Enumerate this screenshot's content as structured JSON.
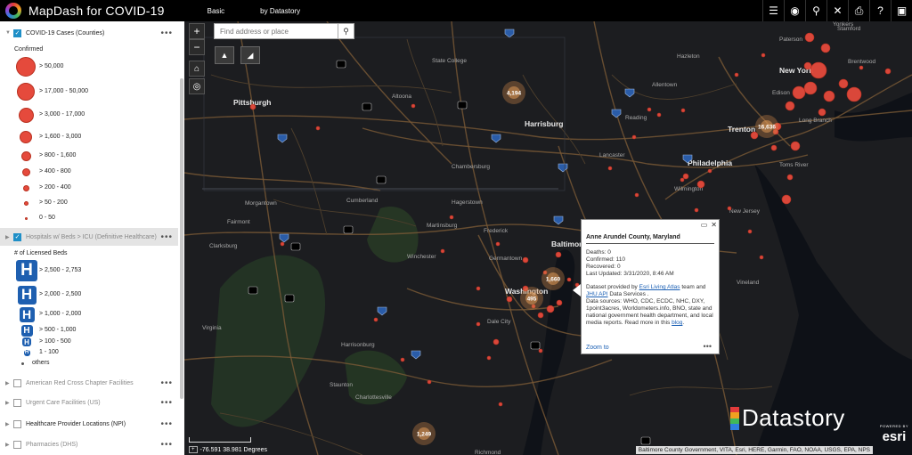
{
  "header": {
    "title": "MapDash for COVID-19",
    "tab": "Basic",
    "by": "by Datastory",
    "tools": [
      {
        "name": "list-icon",
        "glyph": "☰"
      },
      {
        "name": "basemap-icon",
        "glyph": "◉"
      },
      {
        "name": "location-icon",
        "glyph": "⚲"
      },
      {
        "name": "tools-icon",
        "glyph": "✕"
      },
      {
        "name": "print-icon",
        "glyph": "⎙"
      },
      {
        "name": "help-icon",
        "glyph": "?"
      },
      {
        "name": "share-icon",
        "glyph": "▣"
      }
    ]
  },
  "sidebar": {
    "layer1": {
      "name": "COVID-19 Cases (Counties)",
      "legend_title": "Confirmed",
      "classes": [
        "> 50,000",
        "> 17,000 - 50,000",
        "> 3,000 - 17,000",
        "> 1,600 - 3,000",
        "> 800 - 1,600",
        "> 400 - 800",
        "> 200 - 400",
        "> 50 - 200",
        "0 - 50"
      ]
    },
    "layer2": {
      "name": "Hospitals w/ Beds > ICU (Definitive Healthcare)",
      "legend_title": "# of Licensed Beds",
      "classes": [
        "> 2,500 - 2,753",
        "> 2,000 - 2,500",
        "> 1,000 - 2,000",
        "> 500 - 1,000",
        "> 100 - 500",
        "1 - 100",
        "others"
      ]
    },
    "other_layers": [
      "American Red Cross Chapter Facilities",
      "Urgent Care Facilities (US)",
      "Healthcare Provider Locations (NPI)",
      "Pharmacies (DHS)"
    ],
    "menu_glyph": "•••",
    "hospital_glyph": "H"
  },
  "map": {
    "search_placeholder": "Find address or place",
    "zoom_in": "+",
    "zoom_out": "−",
    "cities": [
      {
        "name": "Pittsburgh",
        "big": true
      },
      {
        "name": "Harrisburg",
        "big": true
      },
      {
        "name": "Philadelphia",
        "big": true
      },
      {
        "name": "Washington",
        "big": true
      },
      {
        "name": "Baltimore",
        "big": true
      },
      {
        "name": "Trenton",
        "big": true
      },
      {
        "name": "New York",
        "big": true
      },
      {
        "name": "State College"
      },
      {
        "name": "Altoona"
      },
      {
        "name": "Allentown"
      },
      {
        "name": "Reading"
      },
      {
        "name": "Lancaster"
      },
      {
        "name": "Chambersburg"
      },
      {
        "name": "Hagerstown"
      },
      {
        "name": "Frederick"
      },
      {
        "name": "Wilmington"
      },
      {
        "name": "Morgantown"
      },
      {
        "name": "Fairmont"
      },
      {
        "name": "Clarksburg"
      },
      {
        "name": "Winchester"
      },
      {
        "name": "Martinsburg"
      },
      {
        "name": "Germantown"
      },
      {
        "name": "Dale City"
      },
      {
        "name": "Harrisonburg"
      },
      {
        "name": "Staunton"
      },
      {
        "name": "Charlottesville"
      },
      {
        "name": "Richmond"
      },
      {
        "name": "Cumberland"
      },
      {
        "name": "Vineland"
      },
      {
        "name": "Toms River"
      },
      {
        "name": "Long Branch"
      },
      {
        "name": "Edison"
      },
      {
        "name": "Paterson"
      },
      {
        "name": "Yonkers"
      },
      {
        "name": "Stamford"
      },
      {
        "name": "Brentwood"
      },
      {
        "name": "New Jersey"
      },
      {
        "name": "Virginia"
      },
      {
        "name": "Hazleton"
      }
    ],
    "clusters": [
      {
        "label": "4,194"
      },
      {
        "label": "16,636"
      },
      {
        "label": "1,660"
      },
      {
        "label": "495"
      },
      {
        "label": "1,249"
      }
    ],
    "popup": {
      "title": "Anne Arundel County, Maryland",
      "deaths": "Deaths: 0",
      "confirmed": "Confirmed: 110",
      "recovered": "Recovered: 0",
      "updated": "Last Updated: 3/31/2020, 8:46 AM",
      "src_prefix": "Dataset provided by ",
      "src_link1": "Esri Living Atlas",
      "src_mid": " team and ",
      "src_link2": "JHU API",
      "src_suffix": " Data Services .",
      "sources": "Data sources: WHO, CDC, ECDC, NHC, DXY, 1point3acres, Worldometers.info, BNO, state and national government health department, and local media reports.  Read more in this ",
      "blog": "blog",
      "blog_end": ".",
      "zoom_to": "Zoom to",
      "dots": "•••"
    },
    "attribution": "Baltimore County Government, VITA, Esri, HERE, Garmin, FAO, NOAA, USGS, EPA, NPS",
    "coords": "-76.591 38.981 Degrees",
    "brand": "Datastory",
    "esri": "esri",
    "esri_small": "POWERED BY",
    "colors": {
      "case_dot": "#e54a3c",
      "hospital": "#1e5fb0",
      "road": "#7a5a36",
      "accent": "#1f8fc7"
    }
  }
}
